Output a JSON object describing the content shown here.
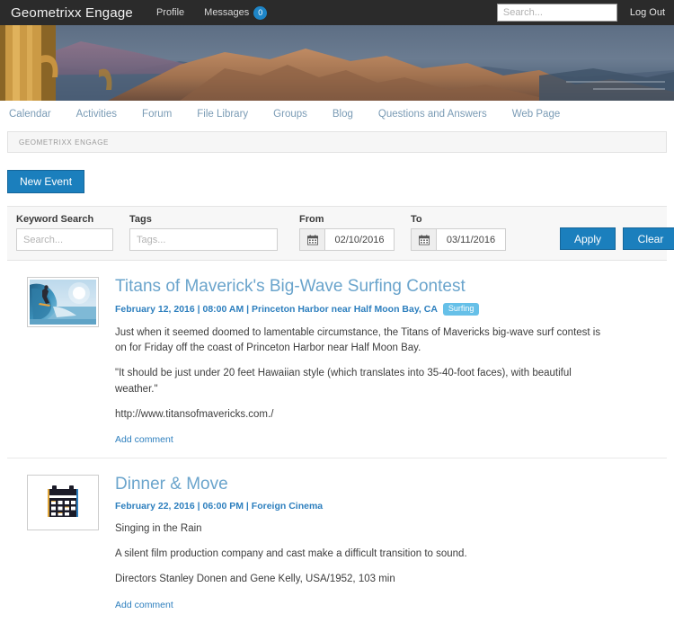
{
  "header": {
    "brand": "Geometrixx Engage",
    "nav": [
      {
        "label": "Profile",
        "name": "profile"
      },
      {
        "label": "Messages",
        "name": "messages"
      }
    ],
    "messages_count": "0",
    "search_placeholder": "Search...",
    "logout_label": "Log Out"
  },
  "tabs": [
    {
      "label": "Calendar"
    },
    {
      "label": "Activities"
    },
    {
      "label": "Forum"
    },
    {
      "label": "File Library"
    },
    {
      "label": "Groups"
    },
    {
      "label": "Blog"
    },
    {
      "label": "Questions and Answers"
    },
    {
      "label": "Web Page"
    }
  ],
  "breadcrumb": "GEOMETRIXX ENGAGE",
  "toolbar": {
    "new_event_label": "New Event"
  },
  "filters": {
    "keyword_label": "Keyword Search",
    "keyword_placeholder": "Search...",
    "keyword_value": "",
    "tags_label": "Tags",
    "tags_placeholder": "Tags...",
    "tags_value": "",
    "from_label": "From",
    "from_value": "02/10/2016",
    "to_label": "To",
    "to_value": "03/11/2016",
    "apply_label": "Apply",
    "clear_label": "Clear"
  },
  "events": [
    {
      "title": "Titans of Maverick's Big-Wave Surfing Contest",
      "date": "February 12, 2016",
      "time": "08:00 AM",
      "location": "Princeton Harbor near Half Moon Bay, CA",
      "meta": "February 12, 2016 | 08:00 AM | Princeton Harbor near Half Moon Bay, CA",
      "tag": "Surfing",
      "thumb_type": "surf-photo",
      "paragraphs": [
        "Just when it seemed doomed to lamentable circumstance, the Titans of Mavericks big-wave surf contest is on for Friday off the coast of Princeton Harbor near Half Moon Bay.",
        "\"It should be just under 20 feet Hawaiian style (which translates into 35-40-foot faces), with beautiful weather.\"",
        "http://www.titansofmavericks.com./"
      ],
      "add_comment_label": "Add comment"
    },
    {
      "title": "Dinner & Move",
      "date": "February 22, 2016",
      "time": "06:00 PM",
      "location": "Foreign Cinema",
      "meta": "February 22, 2016 | 06:00 PM | Foreign Cinema",
      "tag": "",
      "thumb_type": "calendar-icon",
      "paragraphs": [
        "Singing in the Rain",
        "A silent film production company and cast make a difficult transition to sound.",
        "Directors Stanley Donen and Gene Kelly, USA/1952, 103 min"
      ],
      "add_comment_label": "Add comment"
    }
  ],
  "colors": {
    "topbar": "#2b2b2b",
    "accent": "#1b7fbd",
    "link": "#2d7fbe",
    "title": "#6aa4cc",
    "badge": "#66c0e8"
  }
}
